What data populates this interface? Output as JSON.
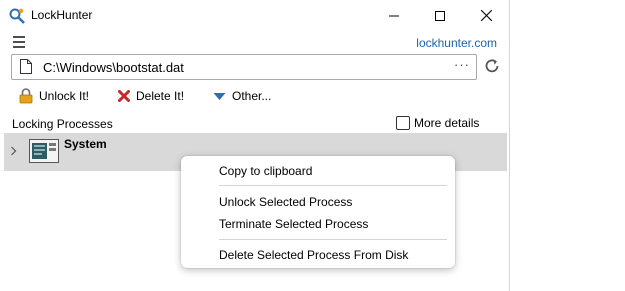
{
  "window": {
    "title": "LockHunter",
    "link": "lockhunter.com"
  },
  "path": {
    "value": "C:\\Windows\\bootstat.dat",
    "browse_label": "···"
  },
  "toolbar": {
    "unlock_label": "Unlock It!",
    "delete_label": "Delete It!",
    "other_label": "Other..."
  },
  "section": {
    "label": "Locking Processes",
    "more_details_label": "More details",
    "more_details_checked": false
  },
  "processes": [
    {
      "name": "System"
    }
  ],
  "context_menu": {
    "copy": "Copy to clipboard",
    "unlock": "Unlock Selected Process",
    "terminate": "Terminate Selected Process",
    "delete_from_disk": "Delete Selected Process From Disk"
  },
  "colors": {
    "link": "#1b63b3",
    "selection": "#d9d9d9",
    "unlock_icon": "#d08a00",
    "delete_icon": "#c62828",
    "other_icon": "#2d6fb6"
  }
}
